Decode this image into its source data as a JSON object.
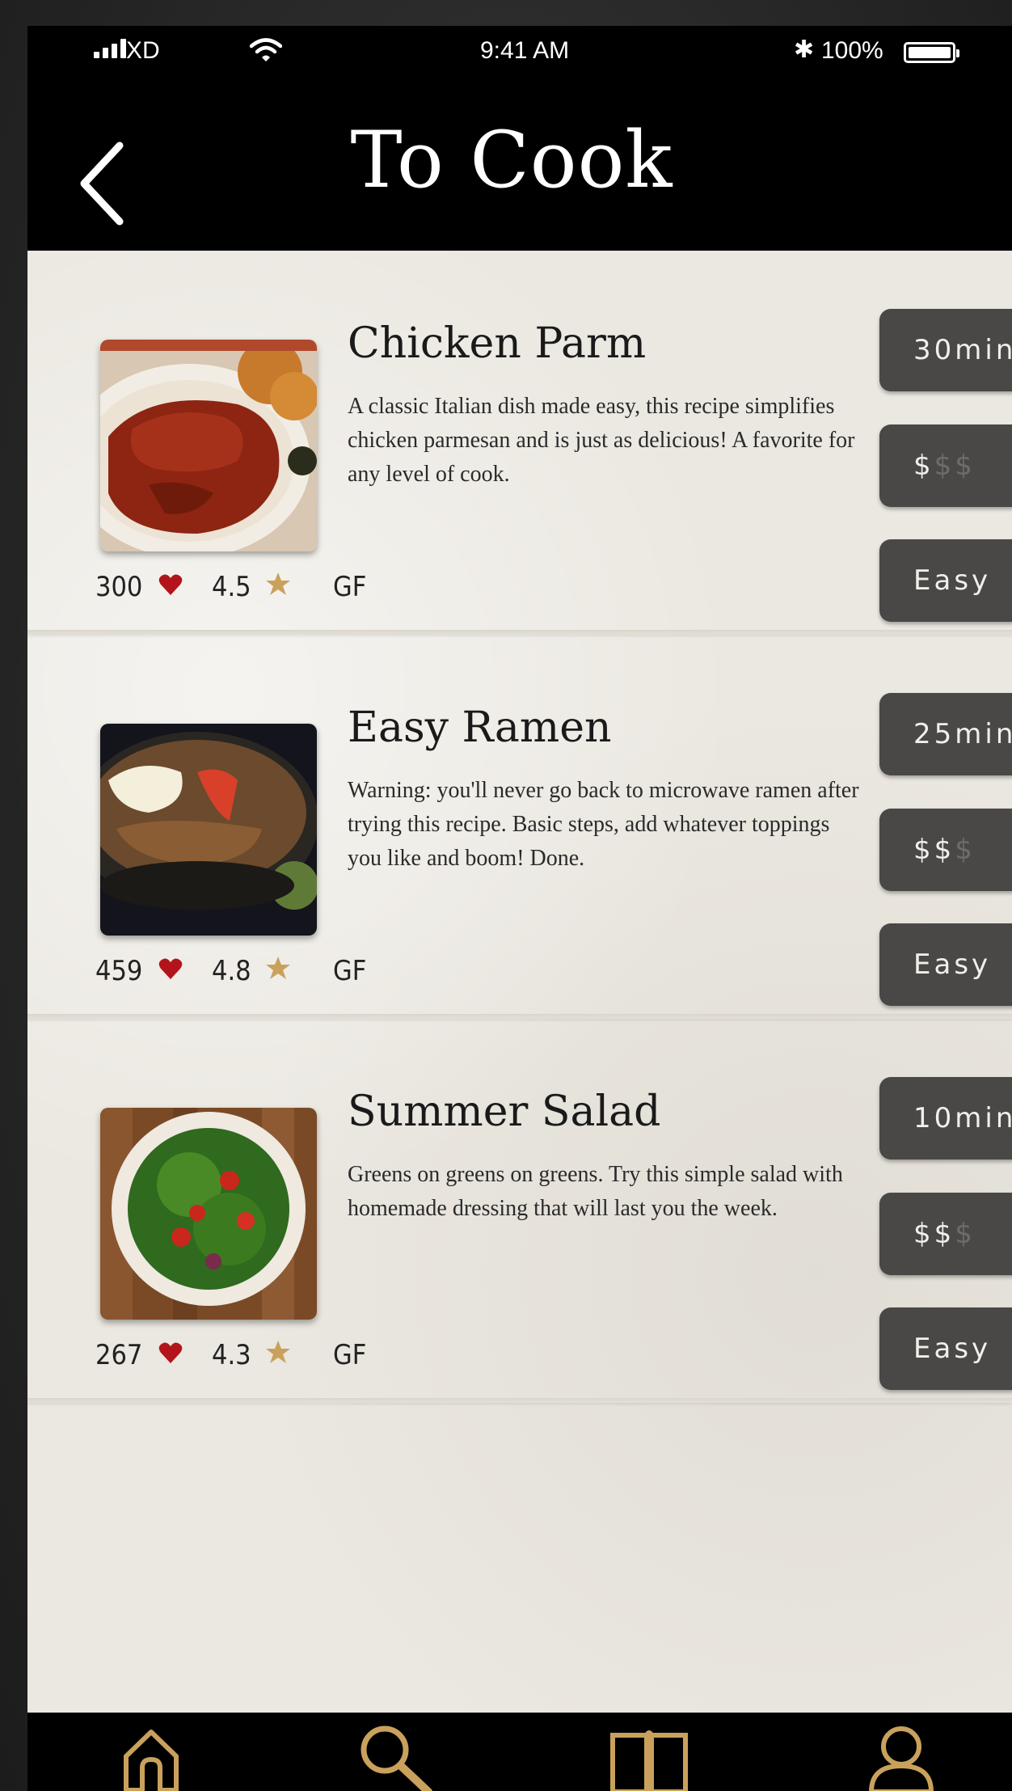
{
  "status_bar": {
    "carrier": "XD",
    "time": "9:41 AM",
    "bluetooth": "✱",
    "battery": "100%"
  },
  "header": {
    "title": "To Cook",
    "back_icon": "chevron-left-icon"
  },
  "recipes": [
    {
      "title": "Chicken Parm",
      "description": "A classic Italian dish made easy, this recipe simplifies chicken parmesan and is just as delicious! A favorite for any level of cook.",
      "likes": "300",
      "rating": "4.5",
      "tag": "GF",
      "time": "30min",
      "price_active": "$",
      "price_inactive": "$$",
      "difficulty": "Easy"
    },
    {
      "title": "Easy Ramen",
      "description": "Warning: you'll never go back to microwave ramen after trying this recipe. Basic steps, add whatever toppings you like and boom! Done.",
      "likes": "459",
      "rating": "4.8",
      "tag": "GF",
      "time": "25min",
      "price_active": "$$",
      "price_inactive": "$",
      "difficulty": "Easy"
    },
    {
      "title": "Summer Salad",
      "description": "Greens on greens on greens. Try this simple salad with homemade dressing that will last you the week.",
      "likes": "267",
      "rating": "4.3",
      "tag": "GF",
      "time": "10min",
      "price_active": "$$",
      "price_inactive": "$",
      "difficulty": "Easy"
    }
  ],
  "tab_bar": [
    "home-icon",
    "search-icon",
    "book-icon",
    "user-icon"
  ],
  "colors": {
    "accent": "#c9a15c",
    "heart": "#b3141c",
    "star": "#c9a15c",
    "pill": "#4a4846",
    "paper": "#ebe8e1"
  }
}
